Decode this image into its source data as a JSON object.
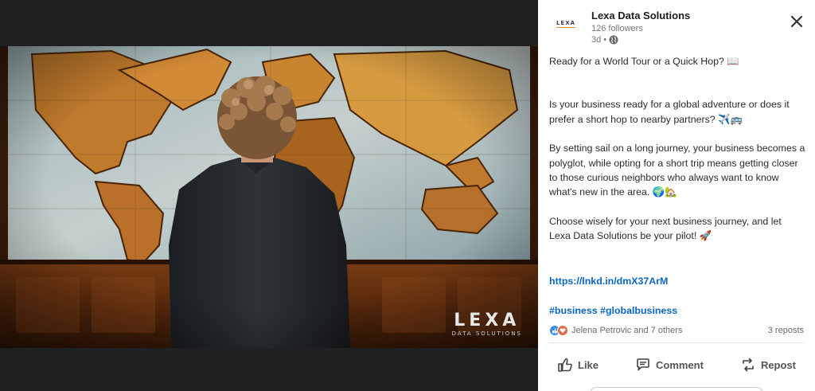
{
  "post": {
    "company": "Lexa Data Solutions",
    "logo_text": "LEXA",
    "followers": "126 followers",
    "age": "3d •",
    "paragraphs": [
      "Ready for a World Tour or a Quick Hop? 📖",
      "Is your business ready for a global adventure or does it prefer a short hop to nearby partners? ✈️🚌",
      "By setting sail on a long journey, your business becomes a polyglot, while opting for a short trip means getting closer to those curious neighbors who always want to know what's new in the area. 🌍🏡",
      "Choose wisely for your next business journey, and let Lexa Data Solutions be your pilot! 🚀"
    ],
    "link": "https://lnkd.in/dmX37ArM",
    "hashtags": "#business #globalbusiness"
  },
  "image": {
    "watermark_main": "LEXA",
    "watermark_sub": "DATA SOLUTIONS"
  },
  "social": {
    "reactions_text": "Jelena Petrovic and 7 others",
    "reposts_text": "3 reposts"
  },
  "actions": {
    "like": "Like",
    "comment": "Comment",
    "repost": "Repost"
  },
  "icons": {
    "close": "close-icon",
    "globe": "globe-icon",
    "like": "thumbs-up-icon",
    "comment": "comment-icon",
    "repost": "repost-icon"
  },
  "colors": {
    "link": "#0a66c2",
    "like_reaction": "#378fe9",
    "love_reaction": "#df704d"
  }
}
